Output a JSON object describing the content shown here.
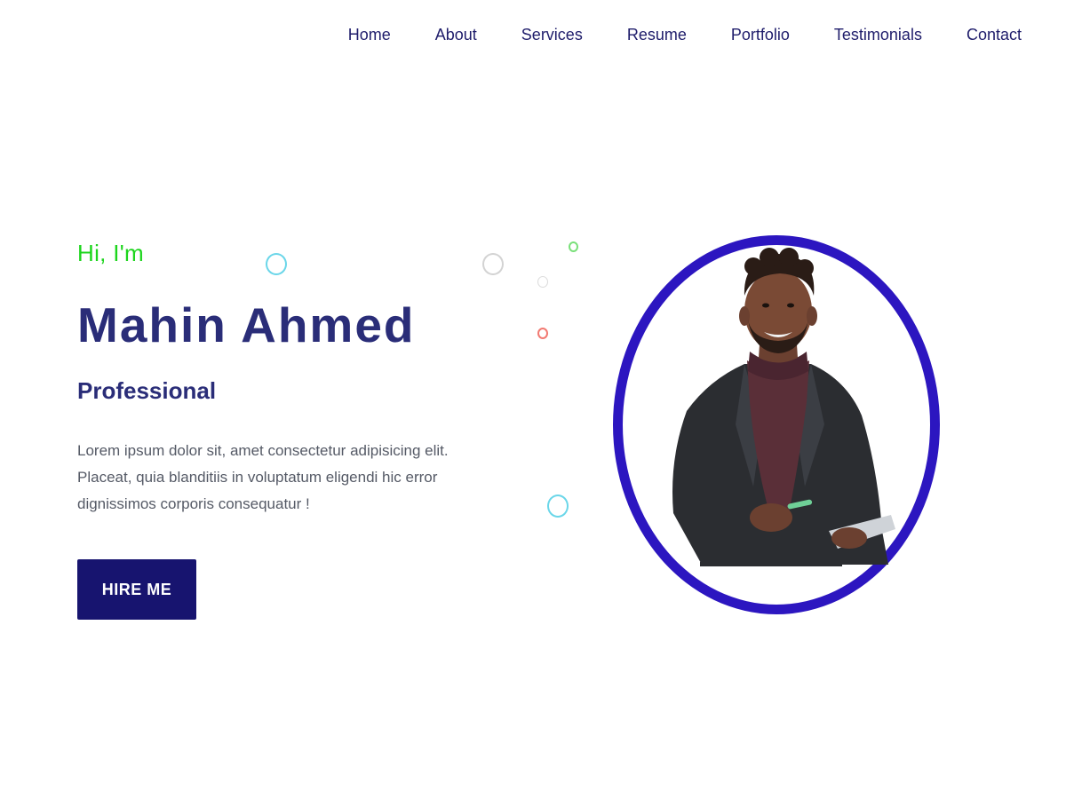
{
  "nav": {
    "items": [
      "Home",
      "About",
      "Services",
      "Resume",
      "Portfolio",
      "Testimonials",
      "Contact"
    ]
  },
  "hero": {
    "greeting": "Hi, I'm",
    "name": "Mahin Ahmed",
    "role": "Professional",
    "description": "Lorem ipsum dolor sit, amet consectetur adipisicing elit. Placeat, quia blanditiis in voluptatum eligendi hic error dignissimos corporis consequatur !",
    "cta_label": "HIRE ME"
  },
  "colors": {
    "accent": "#17146f",
    "heading": "#2a2d78",
    "greeting": "#1cd51c",
    "ring": "#2c16c0"
  },
  "icons": {
    "portrait": "person-portrait-photo"
  }
}
